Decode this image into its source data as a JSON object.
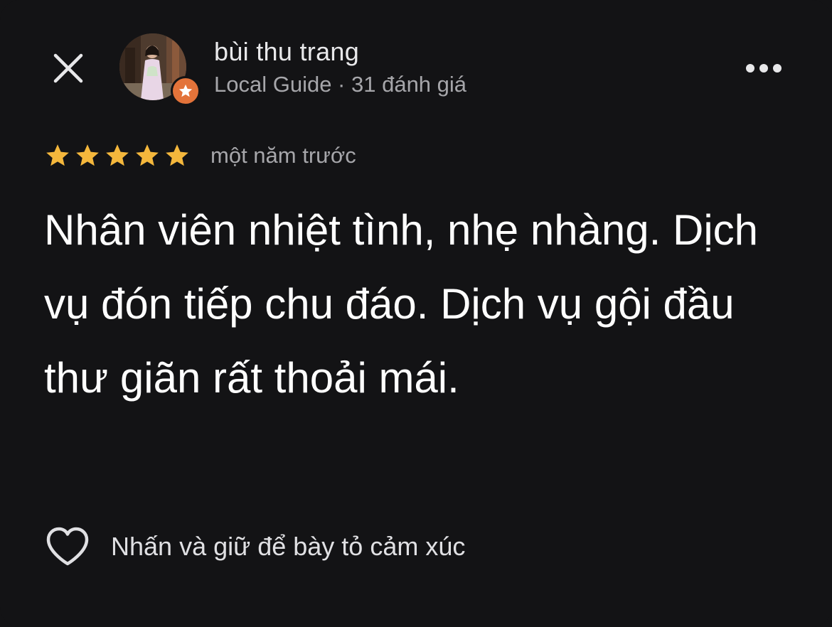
{
  "header": {
    "close_icon": "close-icon",
    "more_icon": "more-horizontal-icon"
  },
  "author": {
    "name": "bùi thu trang",
    "meta": "Local Guide · 31 đánh giá",
    "badge_icon": "local-guide-star-icon",
    "badge_color": "#e3733a"
  },
  "review": {
    "rating": 5,
    "max_rating": 5,
    "star_color": "#f4b73c",
    "date": "một năm trước",
    "text": "Nhân viên nhiệt tình, nhẹ nhàng. Dịch vụ đón tiếp chu đáo. Dịch vụ gội đầu thư giãn rất thoải mái."
  },
  "reaction": {
    "icon": "heart-outline-icon",
    "label": "Nhấn và giữ để bày tỏ cảm xúc"
  },
  "colors": {
    "background": "#131315",
    "text_primary": "#ffffff",
    "text_secondary": "#a6a6aa"
  }
}
